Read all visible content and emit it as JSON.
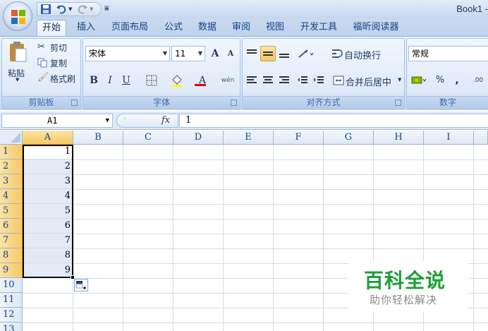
{
  "window": {
    "title": "Book1 -"
  },
  "tabs": [
    {
      "label": "开始",
      "active": true
    },
    {
      "label": "插入"
    },
    {
      "label": "页面布局"
    },
    {
      "label": "公式"
    },
    {
      "label": "数据"
    },
    {
      "label": "审阅"
    },
    {
      "label": "视图"
    },
    {
      "label": "开发工具"
    },
    {
      "label": "福昕阅读器"
    }
  ],
  "ribbon": {
    "clipboard": {
      "label": "剪贴板",
      "paste": "粘贴",
      "cut": "剪切",
      "copy": "复制",
      "format_painter": "格式刷"
    },
    "font": {
      "label": "字体",
      "font_name": "宋体",
      "font_size": "11",
      "bold": "B",
      "italic": "I",
      "underline": "U",
      "font_color_letter": "A",
      "grow": "A",
      "shrink": "A",
      "phonetic": "wén"
    },
    "alignment": {
      "label": "对齐方式",
      "wrap_text": "自动换行",
      "merge_center": "合并后居中"
    },
    "number": {
      "label": "数字",
      "format": "常规",
      "percent": "%",
      "comma": ",",
      "decimals": ".00"
    }
  },
  "formula_bar": {
    "name_box": "A1",
    "fx": "fx",
    "value": "1"
  },
  "grid": {
    "columns": [
      "A",
      "B",
      "C",
      "D",
      "E",
      "F",
      "G",
      "H",
      "I"
    ],
    "rows": [
      "1",
      "2",
      "3",
      "4",
      "5",
      "6",
      "7",
      "8",
      "9",
      "10",
      "11",
      "12",
      "13"
    ],
    "column_a_values": [
      "1",
      "2",
      "3",
      "4",
      "5",
      "6",
      "7",
      "8",
      "9"
    ],
    "selected_range": "A1:A9"
  },
  "watermark": {
    "title": "百科全说",
    "subtitle": "助你轻松解决"
  },
  "colors": {
    "accent": "#15428b",
    "selection_header": "#f6c964",
    "watermark_green": "#1f9e3a"
  }
}
